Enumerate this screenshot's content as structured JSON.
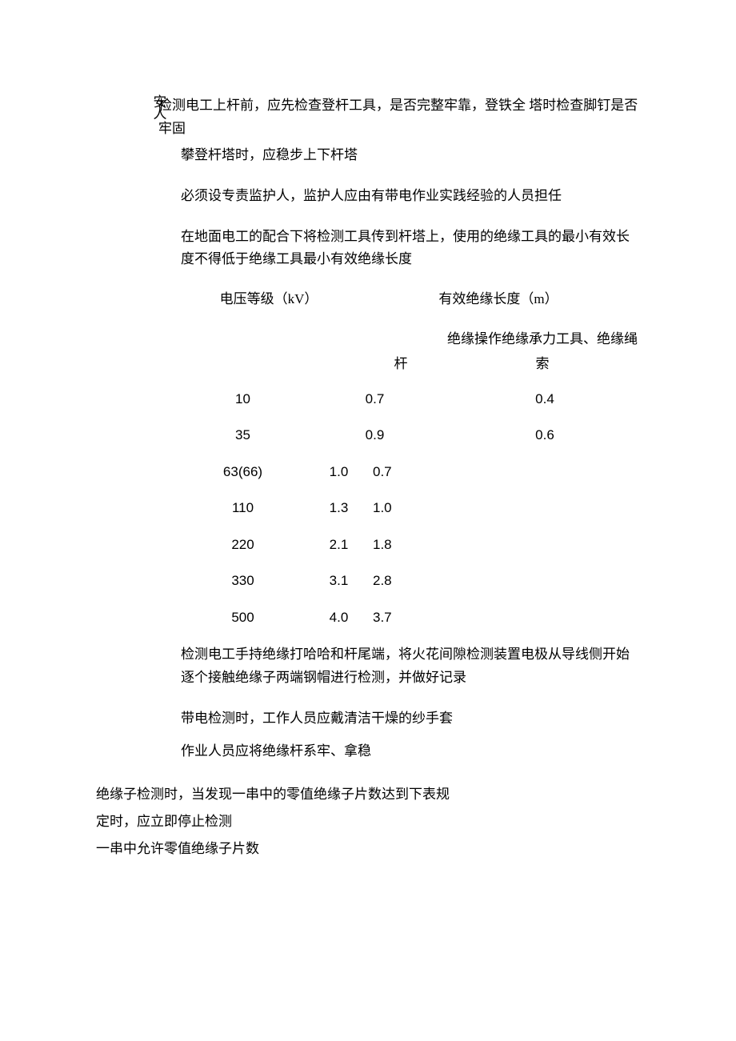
{
  "margin_label": "安人",
  "p1": "检测电工上杆前，应先检查登杆工具，是否完整牢靠，登铁全 塔时检查脚钉是否牢固",
  "p2": "攀登杆塔时，应稳步上下杆塔",
  "p3": "必须设专责监护人，监护人应由有带电作业实践经验的人员担任",
  "p4": "在地面电工的配合下将检测工具传到杆塔上，使用的绝缘工具的最小有效长度不得低于绝缘工具最小有效绝缘长度",
  "table1": {
    "header_a": "电压等级（kV）",
    "header_b": "有效绝缘长度（m）",
    "sub_b": "",
    "sub_c": "绝缘操作绝缘承力工具、绝缘绳",
    "sub2_b": "杆",
    "sub2_c": "索",
    "rows_top": [
      {
        "kv": "10",
        "v1": "0.7",
        "v2": "0.4"
      },
      {
        "kv": "35",
        "v1": "0.9",
        "v2": "0.6"
      }
    ],
    "rows_bottom": [
      {
        "kv": "63(66)",
        "v1": "1.0",
        "v2": "0.7"
      },
      {
        "kv": "110",
        "v1": "1.3",
        "v2": "1.0"
      },
      {
        "kv": "220",
        "v1": "2.1",
        "v2": "1.8"
      },
      {
        "kv": "330",
        "v1": "3.1",
        "v2": "2.8"
      },
      {
        "kv": "500",
        "v1": "4.0",
        "v2": "3.7"
      }
    ]
  },
  "p5": "检测电工手持绝缘打哈哈和杆尾端，将火花间隙检测装置电极从导线侧开始逐个接触绝缘子两端钢帽进行检测，并做好记录",
  "p6": "带电检测时，工作人员应戴清洁干燥的纱手套",
  "p7": "作业人员应将绝缘杆系牢、拿稳",
  "bottom": {
    "l1": "绝缘子检测时，当发现一串中的零值绝缘子片数达到下表规",
    "l2": "定时，应立即停止检测",
    "l3": "一串中允许零值绝缘子片数"
  }
}
